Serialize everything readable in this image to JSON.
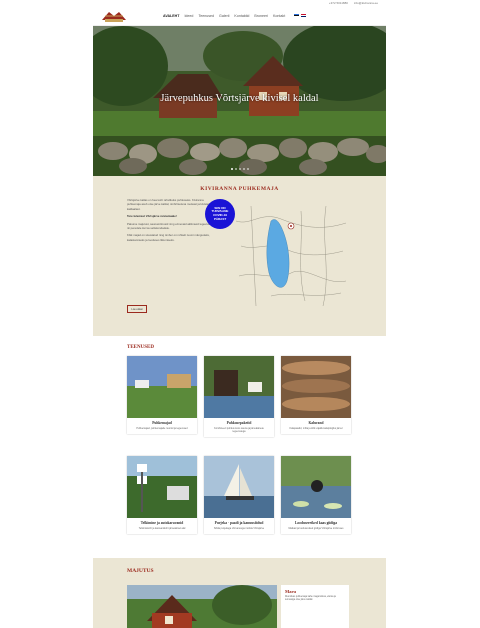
{
  "topbar": {
    "phone": "+372 5011880",
    "email": "info@kiviranna.ee"
  },
  "nav": {
    "items": [
      "AVALEHT",
      "Ideed",
      "Teenused",
      "Galerii",
      "Kontaktid",
      "Broneeri",
      "Kontakt"
    ],
    "active": "AVALEHT"
  },
  "hero": {
    "title": "Järvepuhkus Võrtsjärve kivisel kaldal"
  },
  "about": {
    "title": "KIVIRANNA PUHKEMAJA",
    "badge": "SIIN ON TURVALINE COVID-19 PÄRAST",
    "paragraphs": [
      "Võrtsjärve kallas on hea koht rahulikuks puhkuseks. Kiviranna puhkemaja asub otse järve kaldal, ümbritsetuna metsast ja kivistest kalda­alast.",
      "Pakume majutust, saunamõnusid ning erinevaid aktiivseid tegevusi nii peredele kui ka seltskondadele.",
      "Kõik majad on sisustatud ning ümber on rohkelt ruumi mängudeks, kalastamiseks ja looduses liikumiseks."
    ],
    "highlight": "Tere tulemast Võrtsjärve rannamaale!",
    "more_button": "Loe edasi"
  },
  "services": {
    "title": "TEENUSED",
    "cards": [
      {
        "title": "Puhkemajad",
        "text": "Puhkemajad, puhkemajade ruumid ja tegevused"
      },
      {
        "title": "Puhkusepaketid",
        "text": "Kombineeri puhkus koos sauna ja järveäärsete tegevustega"
      },
      {
        "title": "Kalurand",
        "text": "Kalapaadid, mõla ja kõik vajalik kalapüügiks järvel"
      },
      {
        "title": "Telkimine ja autokaravanid",
        "text": "Telkimiskoht ja karavanikoht järveäärsel alal"
      },
      {
        "title": "Purjeka - paadi ja kanuusõidud",
        "text": "Sõida purjekaga või kanuuga mööda Võrtsjärve"
      },
      {
        "title": "Looduseretked kaas giidiga",
        "text": "Matkad ja loodusretked giidiga Võrtsjärve ümbruses"
      }
    ]
  },
  "majutus": {
    "title": "MAJUTUS",
    "card_title": "Maru",
    "card_text": "Ruumikas puhkemaja kahe magamistoa, elutoa ja terrassiga otse järve kaldal."
  },
  "colors": {
    "accent": "#9b2a1e",
    "badge": "#1a13d6",
    "section_bg": "#ebe6d4"
  }
}
